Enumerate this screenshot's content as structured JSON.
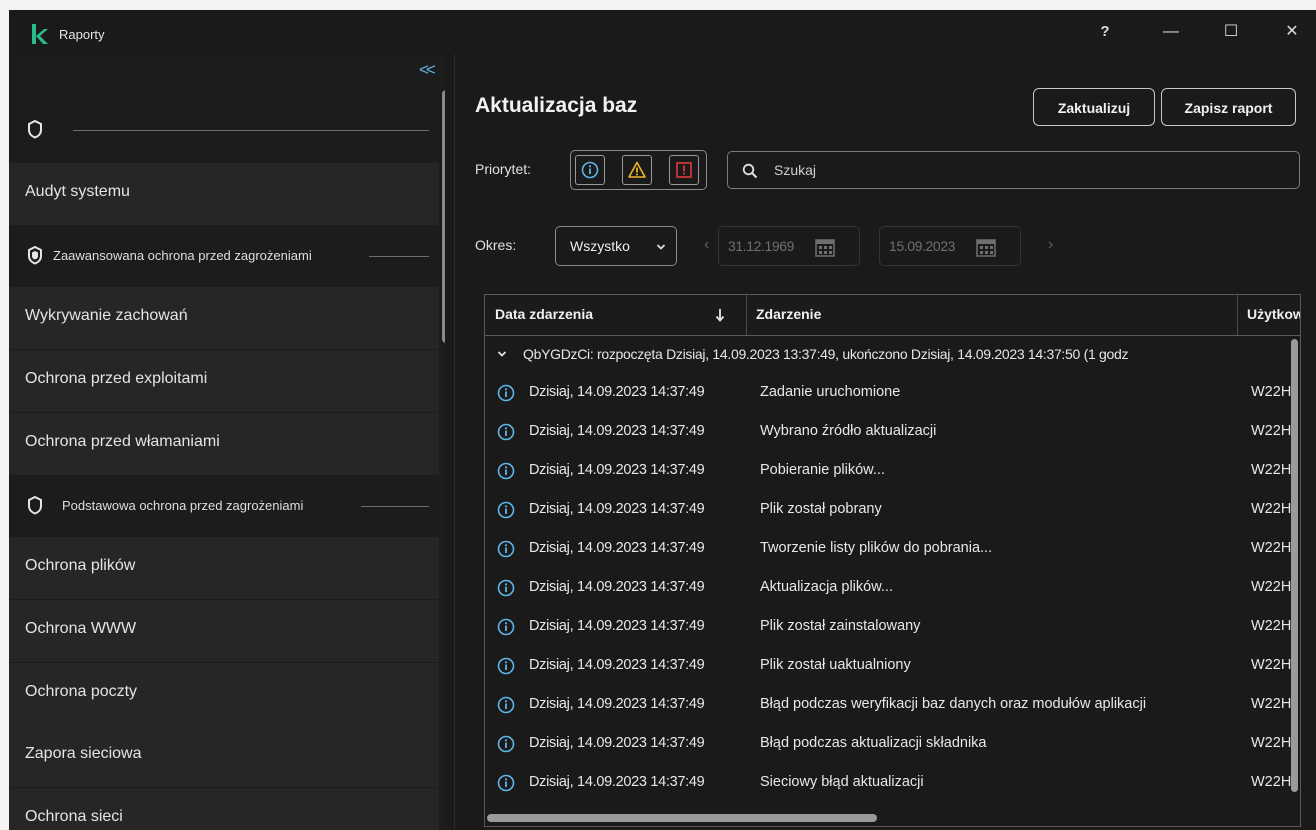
{
  "window": {
    "title": "Raporty"
  },
  "titlebar": {
    "help": "?",
    "minimize": "—",
    "maximize": "☐",
    "close": "✕"
  },
  "sidebar": {
    "groups": [
      {
        "label": ""
      },
      {
        "label": "Zaawansowana ochrona przed zagrożeniami"
      },
      {
        "label": "Podstawowa ochrona przed zagrożeniami"
      }
    ],
    "items": [
      "Audyt systemu",
      "Wykrywanie zachowań",
      "Ochrona przed exploitami",
      "Ochrona przed włamaniami",
      "Ochrona plików",
      "Ochrona WWW",
      "Ochrona poczty",
      "Zapora sieciowa",
      "Ochrona sieci"
    ]
  },
  "main": {
    "title": "Aktualizacja baz",
    "update_button": "Zaktualizuj",
    "save_button": "Zapisz raport",
    "priority_label": "Priorytet:",
    "search_placeholder": "Szukaj",
    "period_label": "Okres:",
    "period_value": "Wszystko",
    "date_from": "31.12.1969",
    "date_to": "15.09.2023"
  },
  "table": {
    "columns": [
      "Data zdarzenia",
      "Zdarzenie",
      "Użytkow"
    ],
    "group": "QbYGDzCi: rozpoczęta Dzisiaj, 14.09.2023 13:37:49, ukończono Dzisiaj, 14.09.2023 14:37:50 (1 godz",
    "rows": [
      {
        "date": "Dzisiaj, 14.09.2023 14:37:49",
        "event": "Zadanie uruchomione",
        "user": "W22H"
      },
      {
        "date": "Dzisiaj, 14.09.2023 14:37:49",
        "event": "Wybrano źródło aktualizacji",
        "user": "W22H"
      },
      {
        "date": "Dzisiaj, 14.09.2023 14:37:49",
        "event": "Pobieranie plików...",
        "user": "W22H"
      },
      {
        "date": "Dzisiaj, 14.09.2023 14:37:49",
        "event": "Plik został pobrany",
        "user": "W22H"
      },
      {
        "date": "Dzisiaj, 14.09.2023 14:37:49",
        "event": "Tworzenie listy plików do pobrania...",
        "user": "W22H"
      },
      {
        "date": "Dzisiaj, 14.09.2023 14:37:49",
        "event": "Aktualizacja plików...",
        "user": "W22H"
      },
      {
        "date": "Dzisiaj, 14.09.2023 14:37:49",
        "event": "Plik został zainstalowany",
        "user": "W22H"
      },
      {
        "date": "Dzisiaj, 14.09.2023 14:37:49",
        "event": "Plik został uaktualniony",
        "user": "W22H"
      },
      {
        "date": "Dzisiaj, 14.09.2023 14:37:49",
        "event": "Błąd podczas weryfikacji baz danych oraz modułów aplikacji",
        "user": "W22H"
      },
      {
        "date": "Dzisiaj, 14.09.2023 14:37:49",
        "event": "Błąd podczas aktualizacji składnika",
        "user": "W22H"
      },
      {
        "date": "Dzisiaj, 14.09.2023 14:37:49",
        "event": "Sieciowy błąd aktualizacji",
        "user": "W22H"
      }
    ]
  },
  "colors": {
    "accent": "#5fb6e6",
    "warning": "#f0b429",
    "error": "#e03c3c",
    "logo": "#29b98b"
  }
}
